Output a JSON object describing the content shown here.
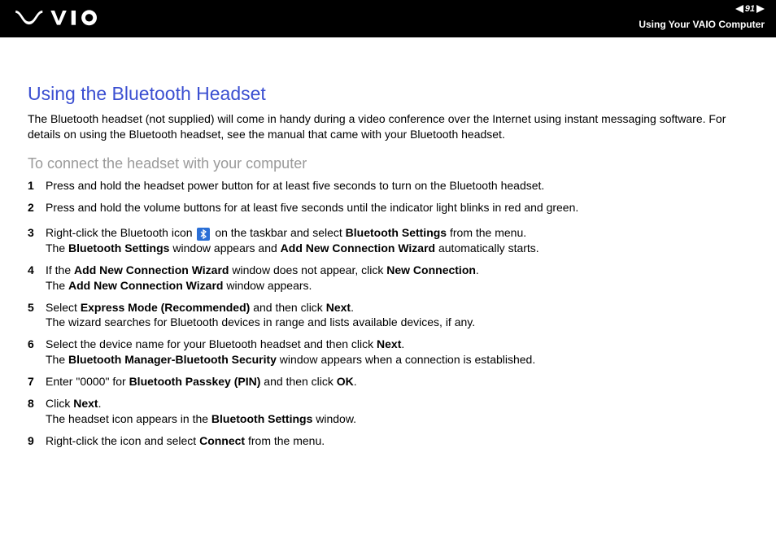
{
  "header": {
    "page_number": "91",
    "breadcrumb": "Using Your VAIO Computer"
  },
  "title": "Using the Bluetooth Headset",
  "intro": "The Bluetooth headset (not supplied) will come in handy during a video conference over the Internet using instant messaging software. For details on using the Bluetooth headset, see the manual that came with your Bluetooth headset.",
  "subheading": "To connect the headset with your computer",
  "steps": {
    "s1": "Press and hold the headset power button for at least five seconds to turn on the Bluetooth headset.",
    "s2": "Press and hold the volume buttons for at least five seconds until the indicator light blinks in red and green.",
    "s3a": "Right-click the Bluetooth icon ",
    "s3b": " on the taskbar and select ",
    "s3c": "Bluetooth Settings",
    "s3d": " from the menu.",
    "s3e": "The ",
    "s3f": "Bluetooth Settings",
    "s3g": " window appears and ",
    "s3h": "Add New Connection Wizard",
    "s3i": " automatically starts.",
    "s4a": "If the ",
    "s4b": "Add New Connection Wizard",
    "s4c": " window does not appear, click ",
    "s4d": "New Connection",
    "s4e": ".",
    "s4f": "The ",
    "s4g": "Add New Connection Wizard",
    "s4h": " window appears.",
    "s5a": "Select ",
    "s5b": "Express Mode (Recommended)",
    "s5c": " and then click ",
    "s5d": "Next",
    "s5e": ".",
    "s5f": "The wizard searches for Bluetooth devices in range and lists available devices, if any.",
    "s6a": "Select the device name for your Bluetooth headset and then click ",
    "s6b": "Next",
    "s6c": ".",
    "s6d": "The ",
    "s6e": "Bluetooth Manager-Bluetooth Security",
    "s6f": " window appears when a connection is established.",
    "s7a": "Enter \"0000\" for ",
    "s7b": "Bluetooth Passkey (PIN)",
    "s7c": " and then click ",
    "s7d": "OK",
    "s7e": ".",
    "s8a": "Click ",
    "s8b": "Next",
    "s8c": ".",
    "s8d": "The headset icon appears in the ",
    "s8e": "Bluetooth Settings",
    "s8f": " window.",
    "s9a": "Right-click the icon and select ",
    "s9b": "Connect",
    "s9c": " from the menu."
  },
  "nums": {
    "n1": "1",
    "n2": "2",
    "n3": "3",
    "n4": "4",
    "n5": "5",
    "n6": "6",
    "n7": "7",
    "n8": "8",
    "n9": "9"
  }
}
